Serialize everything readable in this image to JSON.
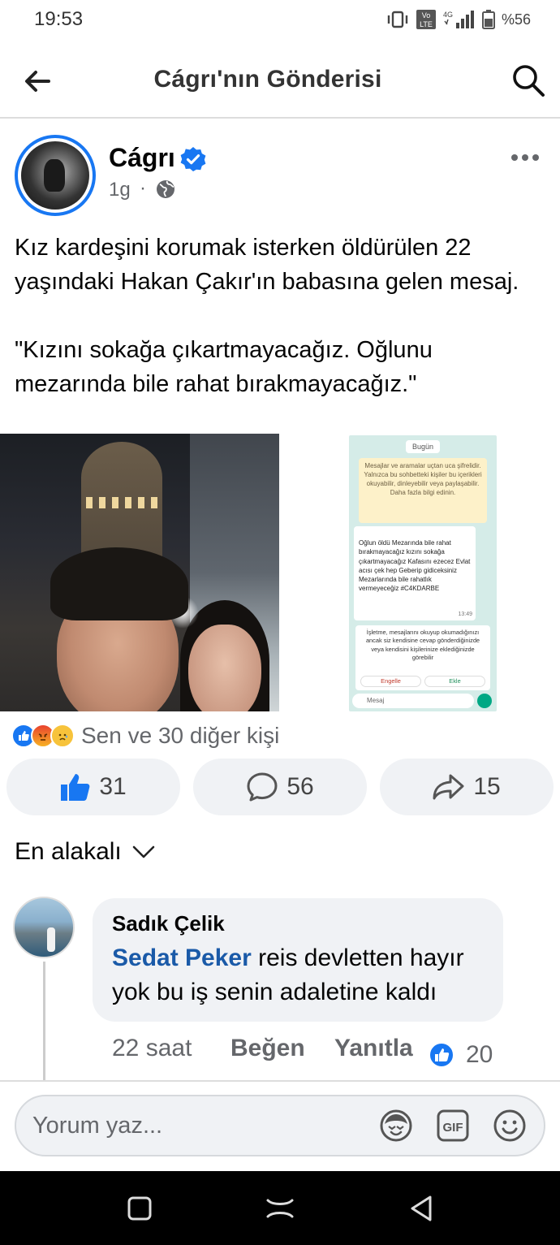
{
  "status_bar": {
    "time": "19:53",
    "battery": "%56",
    "network": "4G",
    "volte": "Vo LTE"
  },
  "header": {
    "title": "Cágrı'nın Gönderisi"
  },
  "post": {
    "author": "Cágrı",
    "time": "1g",
    "separator": "·",
    "text_paragraph_1": "Kız kardeşini korumak isterken öldürülen 22 yaşındaki Hakan Çakır'ın babasına gelen mesaj.",
    "text_paragraph_2": "\"Kızını sokağa çıkartmayacağız. Oğlunu mezarında bile rahat bırakmayacağız.\"",
    "screenshot": {
      "date": "Bugün",
      "system_notice": "Mesajlar ve aramalar uçtan uca şifrelidir. Yalnızca bu sohbetteki kişiler bu içerikleri okuyabilir, dinleyebilir veya paylaşabilir. Daha fazla bilgi edinin.",
      "message": "Oğlun öldü Mezarında bile rahat bırakmayacağız kızını sokağa çıkartmayacağız Kafasını ezecez Evlat acısı çek hep Geberip gidiceksiniz Mezarlarında bile rahatlık vermeyeceğiz #C4KDARBE",
      "message_time": "13:49",
      "business_notice": "İşletme, mesajlarını okuyup okumadığınızı ancak siz kendisine cevap gönderdiğinizde veya kendisini kişilerinize eklediğinizde görebilir",
      "block_label": "Engelle",
      "add_label": "Ekle",
      "input_placeholder": "Mesaj"
    },
    "reactions_text": "Sen ve 30 diğer kişi",
    "like_count": "31",
    "comment_count": "56",
    "share_count": "15"
  },
  "comments": {
    "sort_label": "En alakalı",
    "items": [
      {
        "author": "Sadık Çelik",
        "mention": "Sedat Peker",
        "text": " reis devletten hayır yok bu iş senin adaletine kaldı",
        "time": "22 saat",
        "like_label": "Beğen",
        "reply_label": "Yanıtla",
        "like_count": "20"
      }
    ]
  },
  "composer": {
    "placeholder": "Yorum yaz..."
  },
  "colors": {
    "brand_blue": "#1877f2",
    "mention_blue": "#1a5aa8",
    "secondary_text": "#65676b",
    "bubble_bg": "#f0f2f5"
  },
  "icons": [
    "back-arrow-icon",
    "search-icon",
    "verified-icon",
    "globe-icon",
    "more-icon",
    "like-icon",
    "comment-icon",
    "share-icon",
    "chevron-down-icon",
    "avatar-sticker-icon",
    "gif-icon",
    "emoji-icon",
    "nav-recents-icon",
    "nav-home-icon",
    "nav-back-icon"
  ]
}
